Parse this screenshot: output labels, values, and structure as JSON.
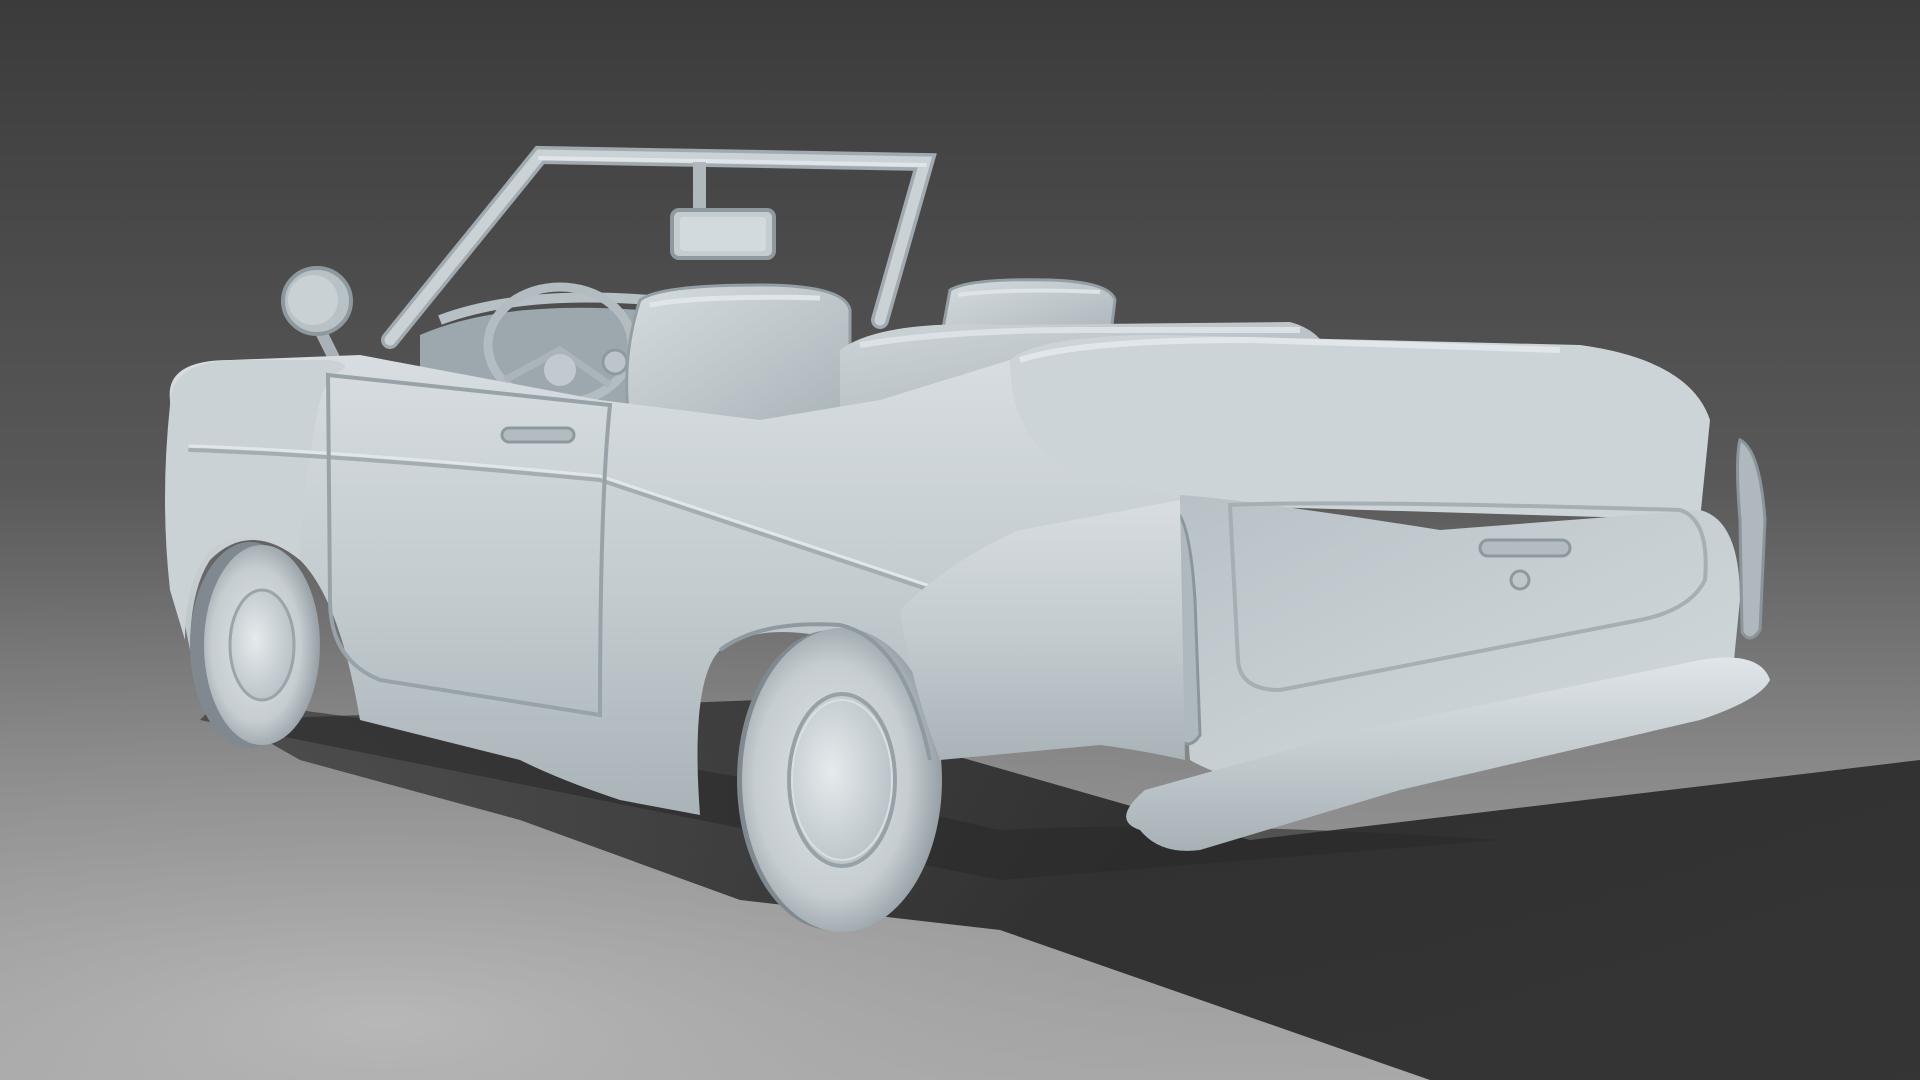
{
  "scene": {
    "subject": "convertible-car-clay-render",
    "colors": {
      "background_top": "#3c3c3c",
      "background_mid": "#5e5e5e",
      "floor_light": "#a9a9a9",
      "floor_far": "#8d8d8d",
      "clay_body": "#c9d1d5",
      "clay_light": "#dde3e6",
      "clay_shadow": "#98a3a9",
      "clay_dark": "#7c868c",
      "cast_shadow": "#2a2a2a"
    }
  }
}
